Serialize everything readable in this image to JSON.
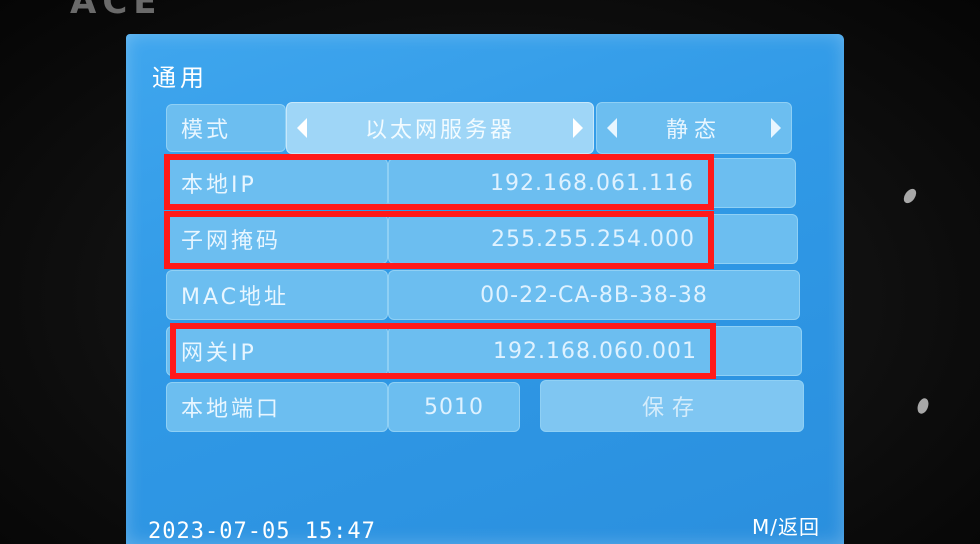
{
  "device": {
    "bezel_logo": "ACE"
  },
  "screen": {
    "title": "通用",
    "mode": {
      "label": "模式",
      "value": "以太网服务器",
      "secondary_value": "静态"
    },
    "rows": [
      {
        "label": "本地IP",
        "value": "192.168.061.116"
      },
      {
        "label": "子网掩码",
        "value": "255.255.254.000"
      },
      {
        "label": "MAC地址",
        "value": "00-22-CA-8B-38-38"
      },
      {
        "label": "网关IP",
        "value": "192.168.060.001"
      }
    ],
    "port": {
      "label": "本地端口",
      "value": "5010"
    },
    "save_label": "保存",
    "footer": {
      "datetime": "2023-07-05 15:47",
      "back_label": "M/返回"
    }
  },
  "colors": {
    "screen_blue": "#3099e6",
    "cell_blue": "#6cbef0",
    "highlight_red": "#ff1a1a"
  }
}
